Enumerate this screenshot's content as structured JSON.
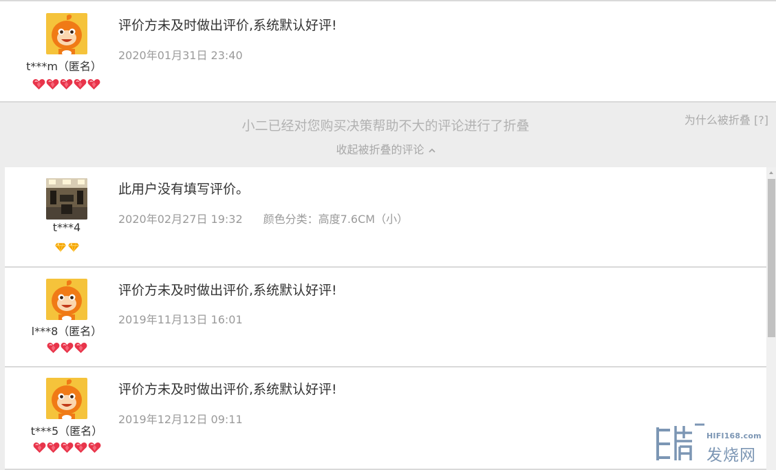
{
  "reviews": [
    {
      "user": "t***m（匿名）",
      "avatar": "taobao-mascot-icon",
      "rank_icon": "red-heart-icon",
      "rank_count": 5,
      "text": "评价方未及时做出评价,系统默认好评!",
      "date": "2020年01月31日 23:40",
      "sku": ""
    },
    {
      "user": "t***4",
      "avatar": "room-photo-avatar",
      "rank_icon": "yellow-diamond-icon",
      "rank_count": 2,
      "text": "此用户没有填写评价。",
      "date": "2020年02月27日 19:32",
      "sku": "颜色分类：高度7.6CM（小）"
    },
    {
      "user": "l***8（匿名）",
      "avatar": "taobao-mascot-icon",
      "rank_icon": "red-heart-icon",
      "rank_count": 3,
      "text": "评价方未及时做出评价,系统默认好评!",
      "date": "2019年11月13日 16:01",
      "sku": ""
    },
    {
      "user": "t***5（匿名）",
      "avatar": "taobao-mascot-icon",
      "rank_icon": "red-heart-icon",
      "rank_count": 5,
      "text": "评价方未及时做出评价,系统默认好评!",
      "date": "2019年12月12日 09:11",
      "sku": ""
    }
  ],
  "fold": {
    "notice": "小二已经对您购买决策帮助不大的评论进行了折叠",
    "toggle_label": "收起被折叠的评论",
    "why_link": "为什么被折叠 [?]"
  },
  "watermark": {
    "domain": "HIFI168.com",
    "name": "发烧网"
  },
  "colors": {
    "page_bg": "#ededed",
    "card_bg": "#ffffff",
    "divider": "#d9d9d9",
    "text": "#333333",
    "meta": "#9a9a9a",
    "mascot_orange": "#f07a16",
    "mascot_bg": "#f5c33b",
    "heart_red": "#e8344a",
    "diamond_yellow": "#f5a400",
    "watermark": "#7c96b4"
  }
}
